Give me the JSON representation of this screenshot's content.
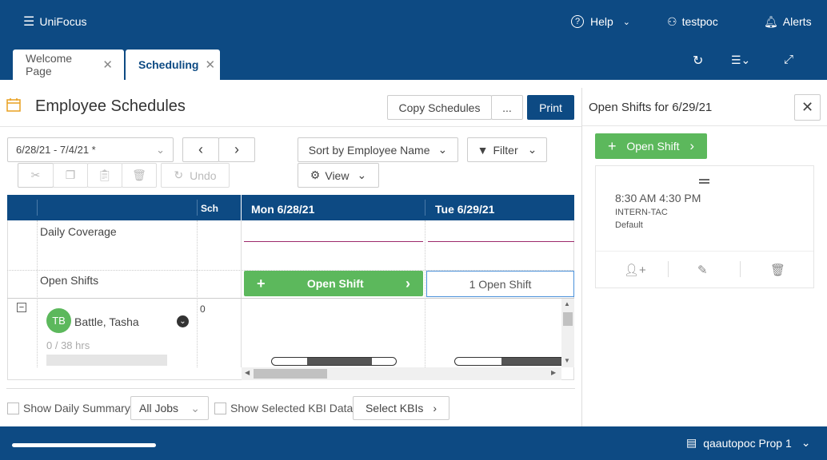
{
  "app": {
    "name": "UniFocus",
    "help": "Help",
    "user": "testpoc",
    "alerts": "Alerts"
  },
  "tabs": [
    {
      "label": "Welcome Page"
    },
    {
      "label": "Scheduling"
    }
  ],
  "page": {
    "title": "Employee Schedules",
    "copy_btn": "Copy Schedules",
    "more_btn": "...",
    "print_btn": "Print"
  },
  "toolbar": {
    "date_range": "6/28/21 - 7/4/21 *",
    "sort": "Sort by Employee Name",
    "filter": "Filter",
    "view": "View",
    "undo": "Undo"
  },
  "grid": {
    "sch_header": "Sch",
    "days": [
      {
        "label": "Mon 6/28/21"
      },
      {
        "label": "Tue 6/29/21"
      }
    ],
    "daily_coverage": "Daily Coverage",
    "open_shifts": "Open Shifts",
    "open_shift_btn": "Open Shift",
    "tue_open_count": "1 Open Shift",
    "employee": {
      "initials": "TB",
      "name": "Battle, Tasha",
      "hours": "0 / 38 hrs",
      "sch": "0"
    }
  },
  "bottom": {
    "daily_summary": "Show Daily Summary",
    "jobs": "All Jobs",
    "kbi": "Show Selected KBI Data",
    "select_kbis": "Select KBIs"
  },
  "panel": {
    "title": "Open Shifts for 6/29/21",
    "add_btn": "Open Shift",
    "shift_time": "8:30 AM 4:30 PM",
    "shift_job": "INTERN-TAC",
    "shift_type": "Default"
  },
  "footer": {
    "property": "qaautopoc Prop 1"
  },
  "colors": {
    "brand": "#0d4a83",
    "green": "#5cb85c",
    "coverage_line": "#9c2a6b"
  }
}
